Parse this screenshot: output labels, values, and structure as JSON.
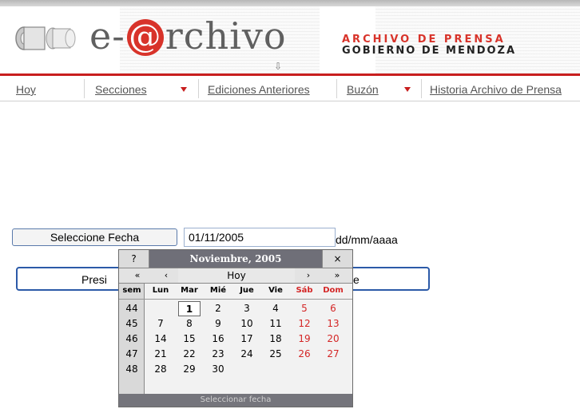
{
  "header": {
    "logo_prefix": "e-",
    "logo_at": "@",
    "logo_suffix": "rchivo",
    "title_line1": "ARCHIVO DE PRENSA",
    "title_line2": "GOBIERNO DE MENDOZA",
    "accent_color": "#d8332a"
  },
  "nav": {
    "items": [
      {
        "label": "Hoy",
        "icon": null
      },
      {
        "label": "Secciones",
        "icon": "dropdown-arrow-icon"
      },
      {
        "label": "Ediciones Anteriores",
        "icon": null
      },
      {
        "label": "Buzón",
        "icon": "dropdown-arrow-icon"
      },
      {
        "label": "Historia Archivo de Prensa",
        "icon": null
      }
    ]
  },
  "form": {
    "select_date_label": "Seleccione Fecha",
    "date_value": "01/11/2005",
    "date_format": "dd/mm/aaaa",
    "press_left": "Presi",
    "press_right": "e"
  },
  "calendar": {
    "help": "?",
    "title": "Noviembre, 2005",
    "close": "×",
    "prev_year": "«",
    "prev_month": "‹",
    "today": "Hoy",
    "next_month": "›",
    "next_year": "»",
    "week_header": "sem",
    "day_names": [
      "Lun",
      "Mar",
      "Mié",
      "Jue",
      "Vie",
      "Sáb",
      "Dom"
    ],
    "weeks": [
      {
        "num": "44",
        "days": [
          "",
          "1",
          "2",
          "3",
          "4",
          "5",
          "6"
        ]
      },
      {
        "num": "45",
        "days": [
          "7",
          "8",
          "9",
          "10",
          "11",
          "12",
          "13"
        ]
      },
      {
        "num": "46",
        "days": [
          "14",
          "15",
          "16",
          "17",
          "18",
          "19",
          "20"
        ]
      },
      {
        "num": "47",
        "days": [
          "21",
          "22",
          "23",
          "24",
          "25",
          "26",
          "27"
        ]
      },
      {
        "num": "48",
        "days": [
          "28",
          "29",
          "30",
          "",
          "",
          "",
          ""
        ]
      }
    ],
    "selected_day": "1",
    "status": "Seleccionar fecha",
    "weekend_color": "#d42626"
  }
}
